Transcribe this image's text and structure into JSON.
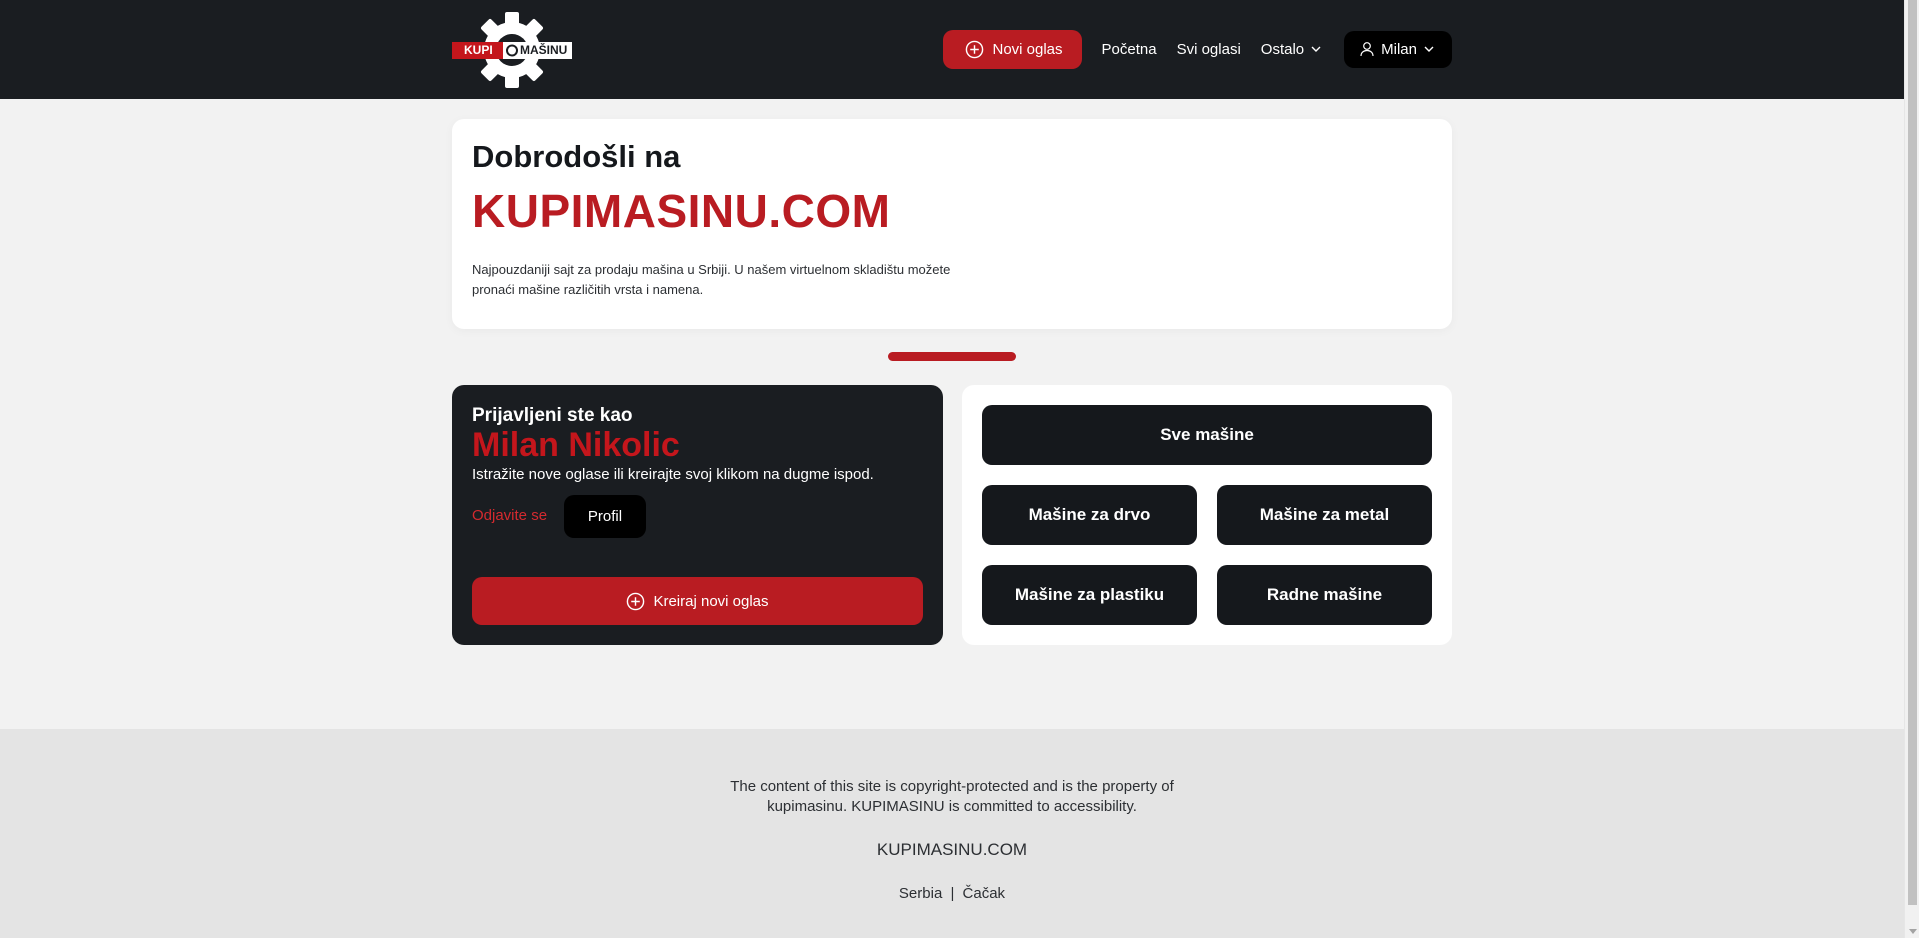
{
  "header": {
    "logo_text_left": "KUPI",
    "logo_text_right": "MAŠINU",
    "new_ad_label": "Novi oglas",
    "nav": {
      "home": "Početna",
      "all_ads": "Svi oglasi",
      "other": "Ostalo"
    },
    "user_label": "Milan",
    "icons": [
      "plus-circle-icon",
      "chevron-down-icon",
      "user-icon"
    ]
  },
  "welcome": {
    "heading": "Dobrodošli na",
    "brand": "KUPIMASINU.COM",
    "description": "Najpouzdaniji sajt za prodaju mašina u Srbiji. U našem virtuelnom skladištu možete pronaći mašine različitih vrsta i namena."
  },
  "account": {
    "logged_in_label": "Prijavljeni ste kao",
    "user_name": "Milan Nikolic",
    "description": "Istražite nove oglase ili kreirajte svoj klikom na dugme ispod.",
    "logout_label": "Odjavite se",
    "profile_label": "Profil",
    "create_label": "Kreiraj novi oglas"
  },
  "categories": {
    "all": "Sve mašine",
    "wood": "Mašine za drvo",
    "metal": "Mašine za metal",
    "plastic": "Mašine za plastiku",
    "work": "Radne mašine"
  },
  "footer": {
    "copyright": "The content of this site is copyright-protected and is the property of kupimasinu. KUPIMASINU is committed to accessibility.",
    "site": "KUPIMASINU.COM",
    "country": "Serbia",
    "separator": "|",
    "city": "Čačak"
  },
  "colors": {
    "accent": "#b91c22",
    "dark": "#1a1d21",
    "background": "#f2f2f2"
  }
}
